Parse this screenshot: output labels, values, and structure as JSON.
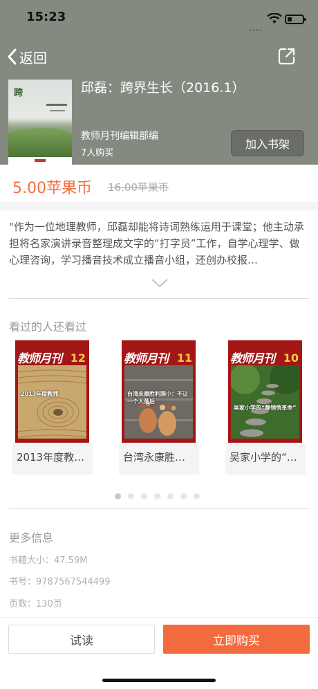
{
  "status_bar": {
    "time": "15:23"
  },
  "header": {
    "back_label": "返回",
    "book_title": "邱磊：跨界生长（2016.1）",
    "author": "教师月刊编辑部编",
    "buyers": "7人购买",
    "add_shelf_label": "加入书架",
    "cover_title": "跨"
  },
  "price": {
    "current": "5.00苹果币",
    "original": "16.00苹果币"
  },
  "description": "\"作为一位地理教师，邱磊却能将诗词熟练运用于课堂；他主动承担将名家演讲录音整理成文字的“打字员”工作，自学心理学、做心理咨询，学习播音技术成立播音小组，还创办校报…",
  "recommend": {
    "title": "看过的人还看过",
    "items": [
      {
        "name": "2013年度教…",
        "masthead": "教师月刊",
        "issue": "12",
        "cover_text": "2013年度教师"
      },
      {
        "name": "台湾永康胜…",
        "masthead": "教师月刊",
        "issue": "11",
        "cover_text": "台湾永康胜利国小：不让一个人落后"
      },
      {
        "name": "吴家小学的“…",
        "masthead": "教师月刊",
        "issue": "10",
        "cover_text": "吴家小学的“静悄悄革命”"
      }
    ],
    "page_count": 7,
    "active_page": 0
  },
  "more_info": {
    "title": "更多信息",
    "size": "书籍大小：47.59M",
    "isbn": "书号：9787567544499",
    "pages": "页数：130页"
  },
  "actions": {
    "try_label": "试读",
    "buy_label": "立即购买"
  },
  "colors": {
    "accent": "#f26b3f",
    "header_bg": "#858a81"
  }
}
